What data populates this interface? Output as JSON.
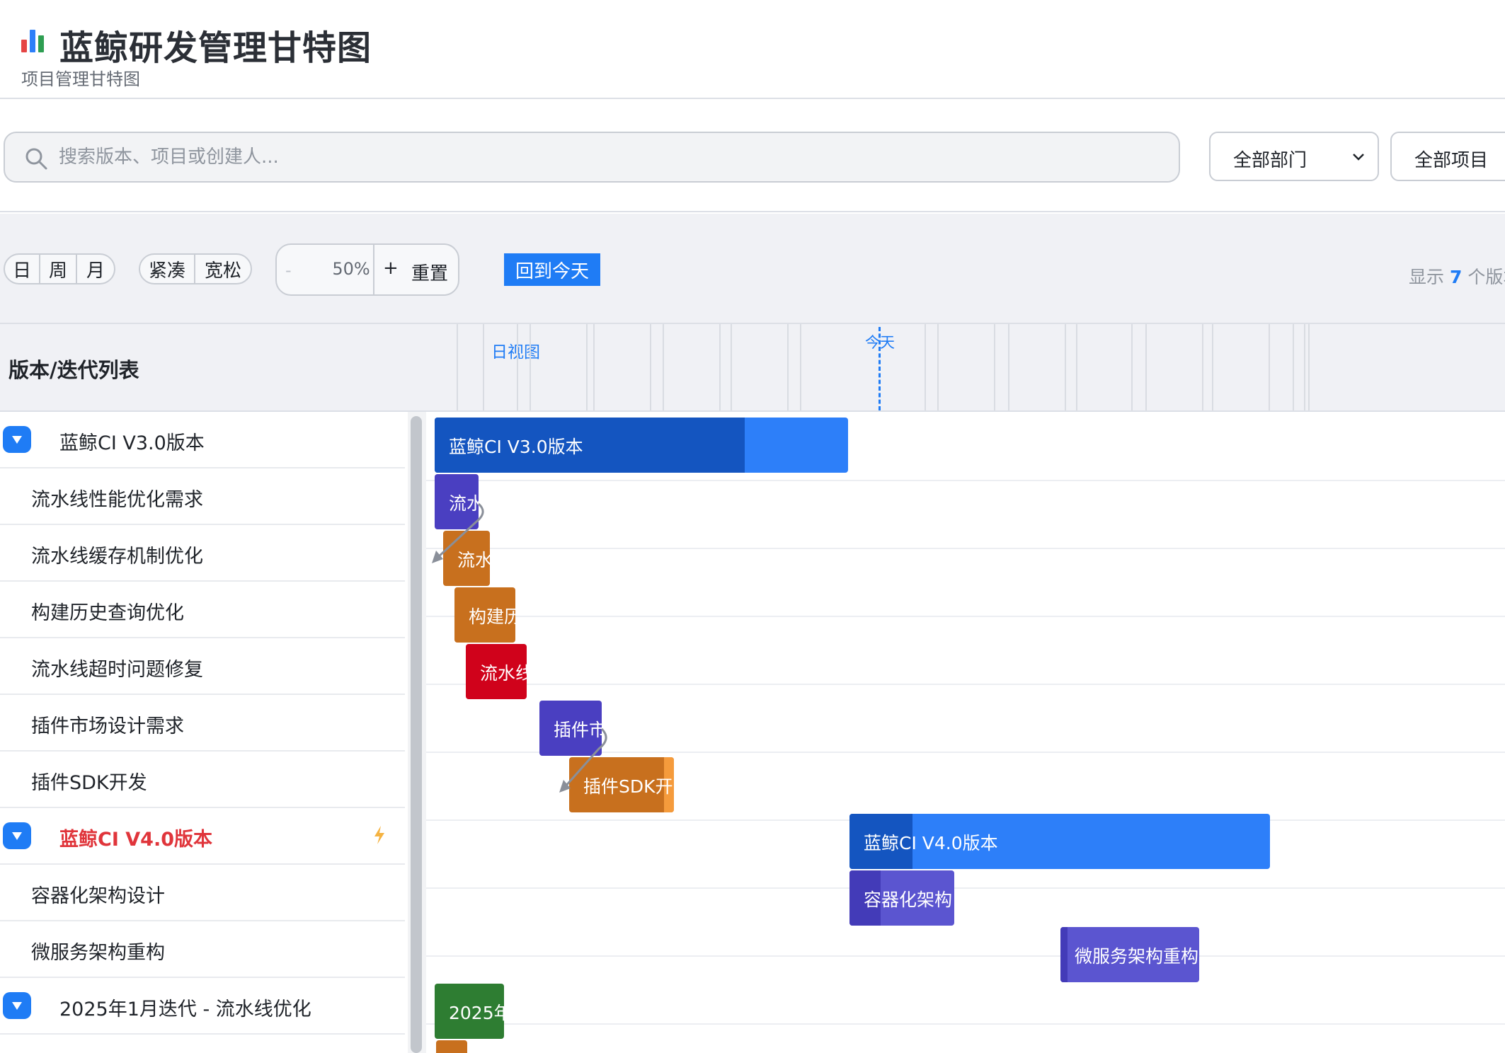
{
  "header": {
    "title": "蓝鲸研发管理甘特图",
    "subtitle": "项目管理甘特图"
  },
  "filters": {
    "search_placeholder": "搜索版本、项目或创建人...",
    "department": "全部部门",
    "project": "全部项目"
  },
  "toolbar": {
    "scale_options": [
      "日",
      "周",
      "月"
    ],
    "density_options": [
      "紧凑",
      "宽松"
    ],
    "zoom_minus": "-",
    "zoom_value": "50%",
    "zoom_plus": "+",
    "reset": "重置",
    "back_to_today": "回到今天",
    "count_prefix": "显示",
    "count_value": "7",
    "count_suffix": "个版本"
  },
  "gantt": {
    "list_title": "版本/迭代列表",
    "view_label": "日视图",
    "today_label": "今天",
    "rows": [
      {
        "type": "version",
        "name": "蓝鲸CI V3.0版本",
        "bar_label": "蓝鲸CI V3.0版本",
        "progress": 0.75
      },
      {
        "type": "task",
        "name": "流水线性能优化需求",
        "bar_label": "流水"
      },
      {
        "type": "task",
        "name": "流水线缓存机制优化",
        "bar_label": "流水"
      },
      {
        "type": "task",
        "name": "构建历史查询优化",
        "bar_label": "构建历"
      },
      {
        "type": "task",
        "name": "流水线超时问题修复",
        "bar_label": "流水线"
      },
      {
        "type": "task",
        "name": "插件市场设计需求",
        "bar_label": "插件市"
      },
      {
        "type": "task",
        "name": "插件SDK开发",
        "bar_label": "插件SDK开"
      },
      {
        "type": "version",
        "name": "蓝鲸CI V4.0版本",
        "bar_label": "蓝鲸CI V4.0版本",
        "highlight": true,
        "progress": 0.15
      },
      {
        "type": "task",
        "name": "容器化架构设计",
        "bar_label": "容器化架构"
      },
      {
        "type": "task",
        "name": "微服务架构重构",
        "bar_label": "微服务架构重构"
      },
      {
        "type": "version",
        "name": "2025年1月迭代 - 流水线优化",
        "bar_label": "2025年"
      }
    ]
  },
  "colors": {
    "accent": "#1f7cf5",
    "version_bar": "#2d7ff9",
    "version_progress": "#1455c0",
    "feature_bar": "#4a3fc1",
    "task_bar": "#c8701e",
    "bug_bar": "#d0021b",
    "iteration_bar": "#2e7d32",
    "highlight_text": "#e0353b"
  },
  "icons": [
    "bar-chart-icon",
    "search-icon",
    "chevron-down-icon",
    "triangle-down-icon",
    "lightning-icon"
  ]
}
